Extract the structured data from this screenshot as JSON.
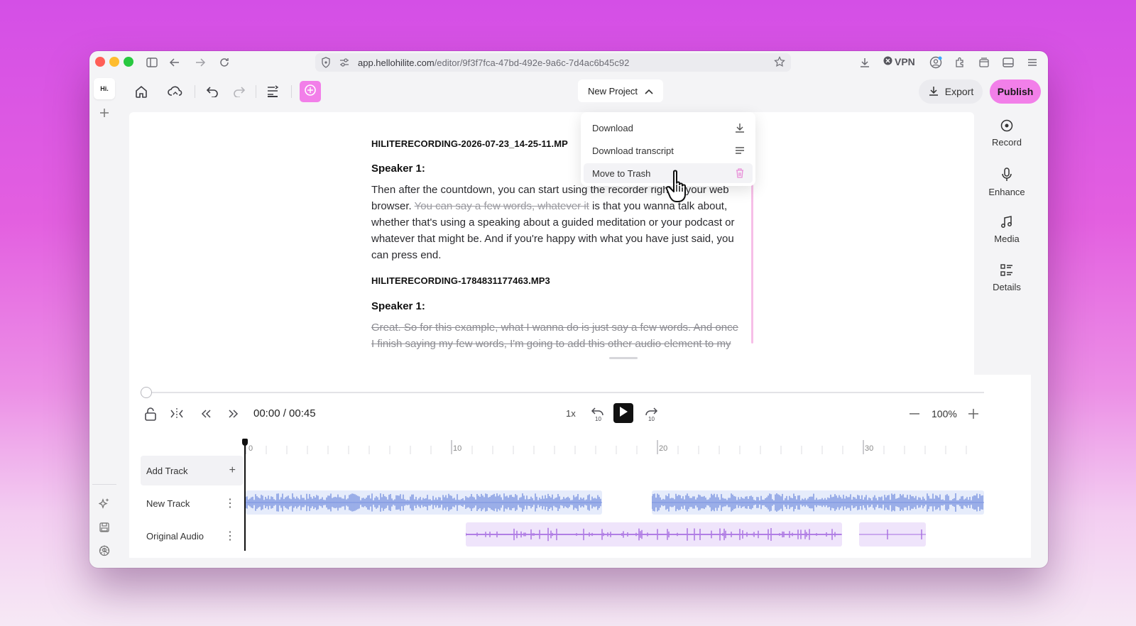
{
  "browser": {
    "url_host": "app.hellohilite.com",
    "url_path": "/editor/9f3f7fca-47bd-492e-9a6c-7d4ac6b45c92",
    "vpn_label": "VPN"
  },
  "app": {
    "logo": "Hi.",
    "project_name": "New Project",
    "export_label": "Export",
    "publish_label": "Publish",
    "accent_color": "#f27fe9"
  },
  "dropdown": {
    "items": [
      {
        "label": "Download",
        "icon": "download-icon"
      },
      {
        "label": "Download transcript",
        "icon": "lines-icon"
      },
      {
        "label": "Move to Trash",
        "icon": "trash-icon"
      }
    ]
  },
  "right_panel": {
    "items": [
      {
        "label": "Record",
        "icon": "record-icon"
      },
      {
        "label": "Enhance",
        "icon": "mic-icon"
      },
      {
        "label": "Media",
        "icon": "music-icon"
      },
      {
        "label": "Details",
        "icon": "details-icon"
      }
    ]
  },
  "transcript": {
    "file1": "HILITERECORDING-2026-07-23_14-25-11.MP",
    "speaker1": "Speaker 1:",
    "para1_a": "Then after the countdown, you can start using the recorder right in your web browser. ",
    "para1_strike": "You can say a few words, whatever it",
    "para1_b": " is that you wanna talk about, whether that's using a speaking about a guided meditation or your podcast or whatever that might be. And if you're happy with what you have just said, you can press end.",
    "file2": "HILITERECORDING-1784831177463.MP3",
    "speaker2": "Speaker 1:",
    "para2": "Great. So for this example, what I wanna do is just say a few words. And once I finish saying my few words, I'm going to add this other audio element to my"
  },
  "player": {
    "timecode": "00:00 / 00:45",
    "speed": "1x",
    "skip_back": "10",
    "skip_forward": "10",
    "zoom": "100%",
    "progress": 0
  },
  "timeline": {
    "ticks": [
      "0",
      "10",
      "20",
      "30"
    ],
    "tracks": [
      {
        "label": "Add Track",
        "action": "+"
      },
      {
        "label": "New Track",
        "action": "⋮"
      },
      {
        "label": "Original Audio",
        "action": "⋮"
      }
    ],
    "track_color_new": "#7b94e0",
    "track_color_original": "#a66ce0"
  }
}
